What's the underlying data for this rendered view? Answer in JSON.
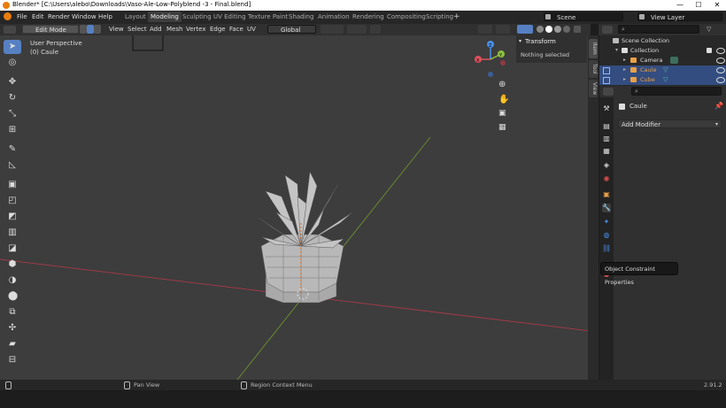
{
  "window": {
    "title": "Blender* [C:\\Users\\alebo\\Downloads\\Vaso-Ale-Low-Polyblend -3 - Final.blend]",
    "minimize": "—",
    "maximize": "☐",
    "close": "✕"
  },
  "menus": [
    "File",
    "Edit",
    "Render",
    "Window",
    "Help"
  ],
  "workspaces": [
    "Layout",
    "Modeling",
    "Sculpting",
    "UV Editing",
    "Texture Paint",
    "Shading",
    "Animation",
    "Rendering",
    "Compositing",
    "Scripting"
  ],
  "active_workspace": "Modeling",
  "add_workspace": "+",
  "scene": {
    "label": "Scene"
  },
  "view_layer": {
    "label": "View Layer"
  },
  "header": {
    "mode": "Edit Mode",
    "menus": [
      "View",
      "Select",
      "Add",
      "Mesh",
      "Vertex",
      "Edge",
      "Face",
      "UV"
    ],
    "orientation": "Global"
  },
  "viewport": {
    "perspective": "User Perspective",
    "object": "(0) Caule",
    "gizmo": {
      "x": "X",
      "y": "Y",
      "z": "Z"
    }
  },
  "npanel": {
    "title": "Transform",
    "content": "Nothing selected",
    "tabs": [
      "Item",
      "Tool",
      "View"
    ]
  },
  "outliner": {
    "scene_collection": "Scene Collection",
    "collection": "Collection",
    "items": [
      {
        "label": "Camera",
        "selected": false
      },
      {
        "label": "Caule",
        "selected": true
      },
      {
        "label": "Cube",
        "selected": true
      }
    ]
  },
  "properties": {
    "object_name": "Caule",
    "add_modifier": "Add Modifier",
    "tooltip": "Object Constraint Properties"
  },
  "statusbar": {
    "pan": "Pan View",
    "context": "Region Context Menu",
    "version": "2.91.2"
  },
  "colors": {
    "accent": "#5680c2",
    "viewport": "#3d3d3d",
    "selected_row": "#334d80",
    "axis_x": "#e0505d",
    "axis_y": "#8fbf3f",
    "axis_z": "#4a8fe8"
  }
}
